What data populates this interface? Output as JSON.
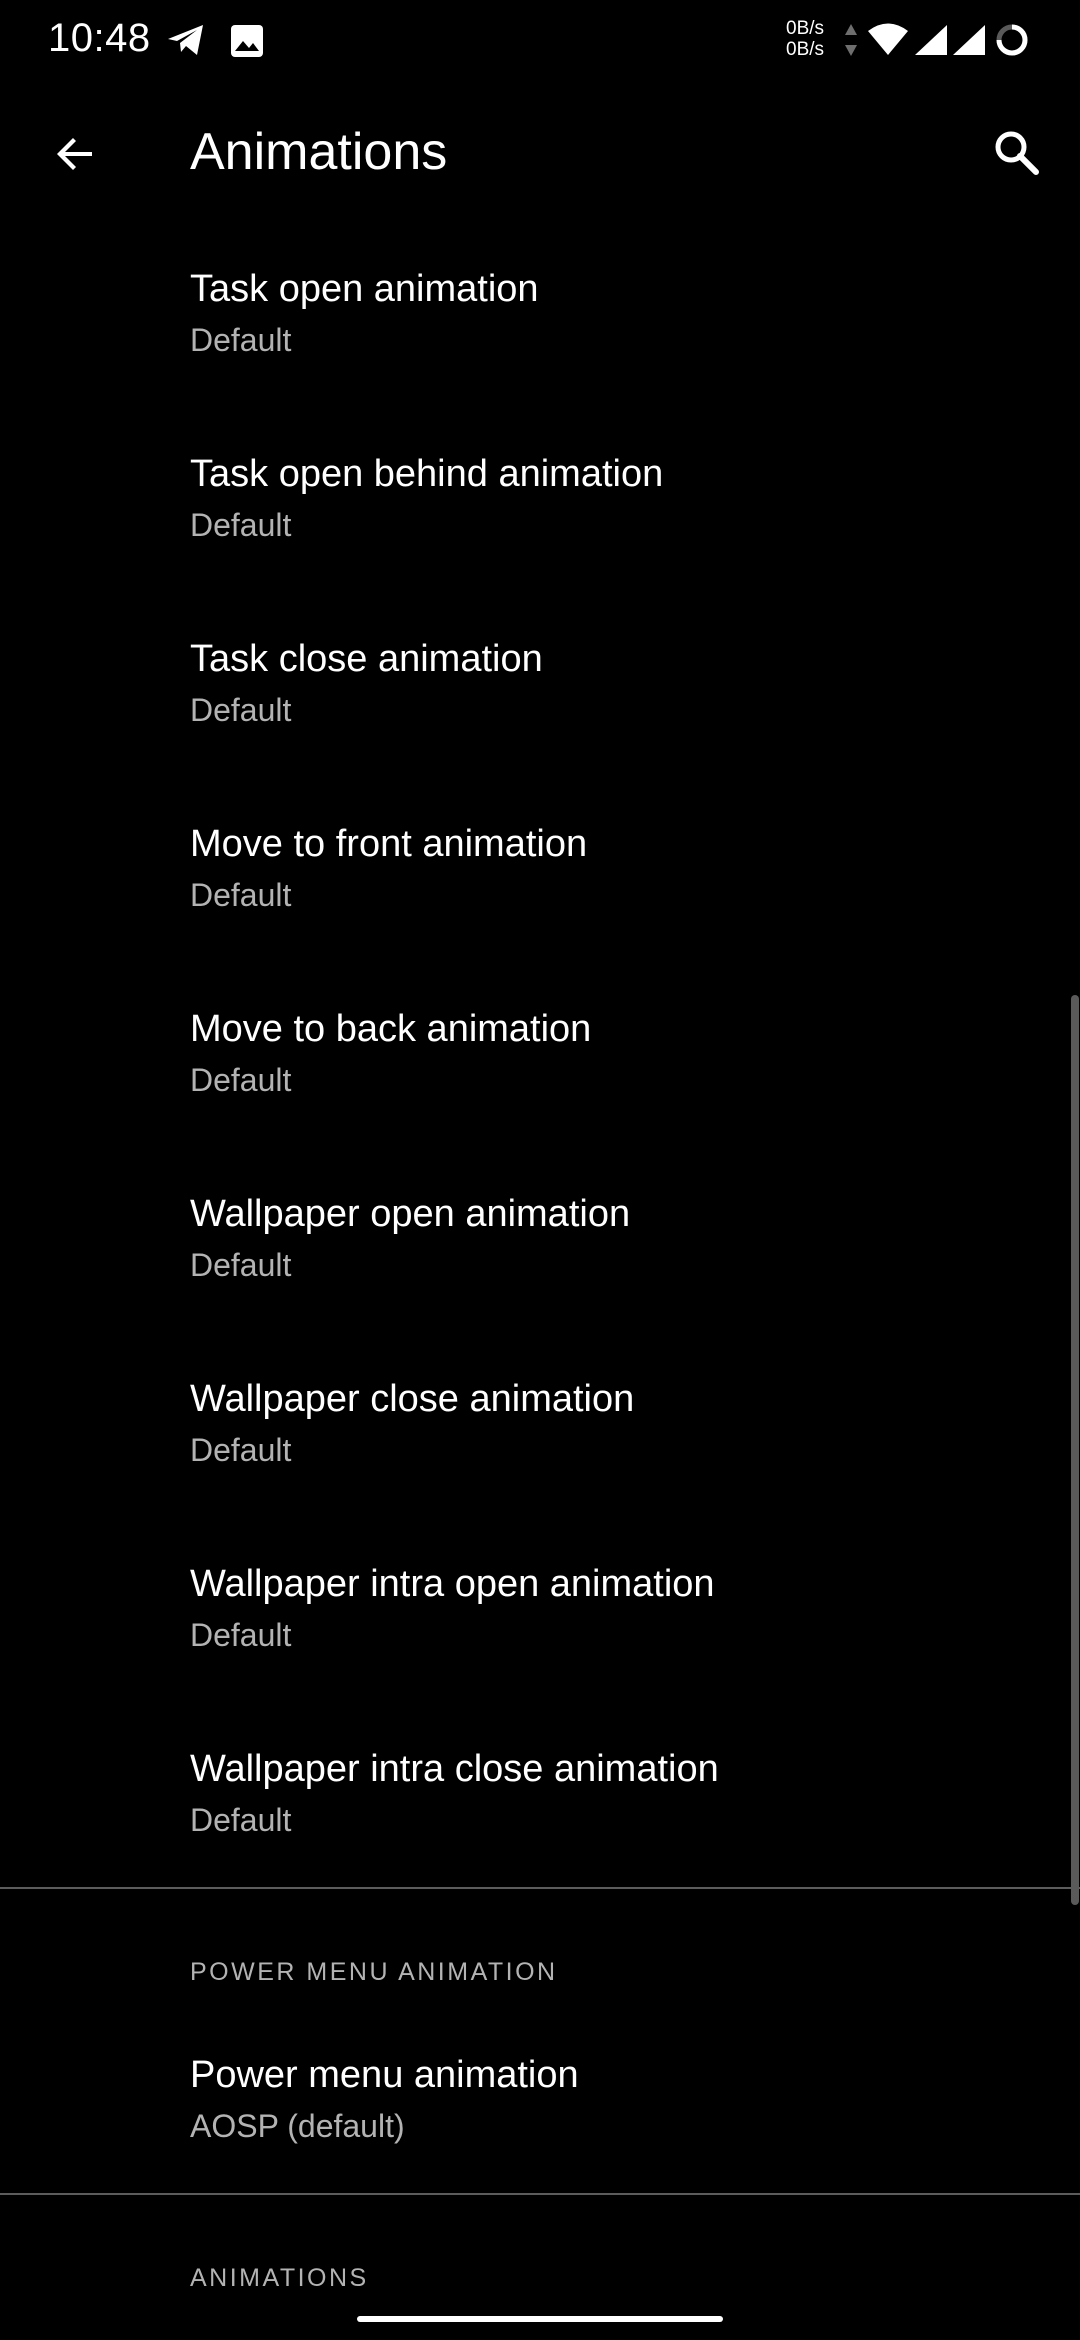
{
  "status_bar": {
    "time": "10:48",
    "net_up": "0B/s",
    "net_down": "0B/s",
    "icons": [
      "telegram-icon",
      "image-icon",
      "data-arrows-icon",
      "wifi-icon",
      "signal-icon",
      "signal-icon-2",
      "battery-ring-icon"
    ]
  },
  "app_bar": {
    "title": "Animations",
    "back_icon": "arrow-back-icon",
    "search_icon": "search-icon"
  },
  "items": [
    {
      "title": "Task open animation",
      "value": "Default"
    },
    {
      "title": "Task open behind animation",
      "value": "Default"
    },
    {
      "title": "Task close animation",
      "value": "Default"
    },
    {
      "title": "Move to front animation",
      "value": "Default"
    },
    {
      "title": "Move to back animation",
      "value": "Default"
    },
    {
      "title": "Wallpaper open animation",
      "value": "Default"
    },
    {
      "title": "Wallpaper close animation",
      "value": "Default"
    },
    {
      "title": "Wallpaper intra open animation",
      "value": "Default"
    },
    {
      "title": "Wallpaper intra close animation",
      "value": "Default"
    }
  ],
  "sections": {
    "power_menu": {
      "header": "POWER MENU ANIMATION",
      "item": {
        "title": "Power menu animation",
        "value": "AOSP (default)"
      }
    },
    "animations": {
      "header": "ANIMATIONS"
    }
  },
  "colors": {
    "background": "#000000",
    "primary_text": "#ffffff",
    "secondary_text": "#b3b3b3",
    "divider": "#5c5c5c"
  }
}
